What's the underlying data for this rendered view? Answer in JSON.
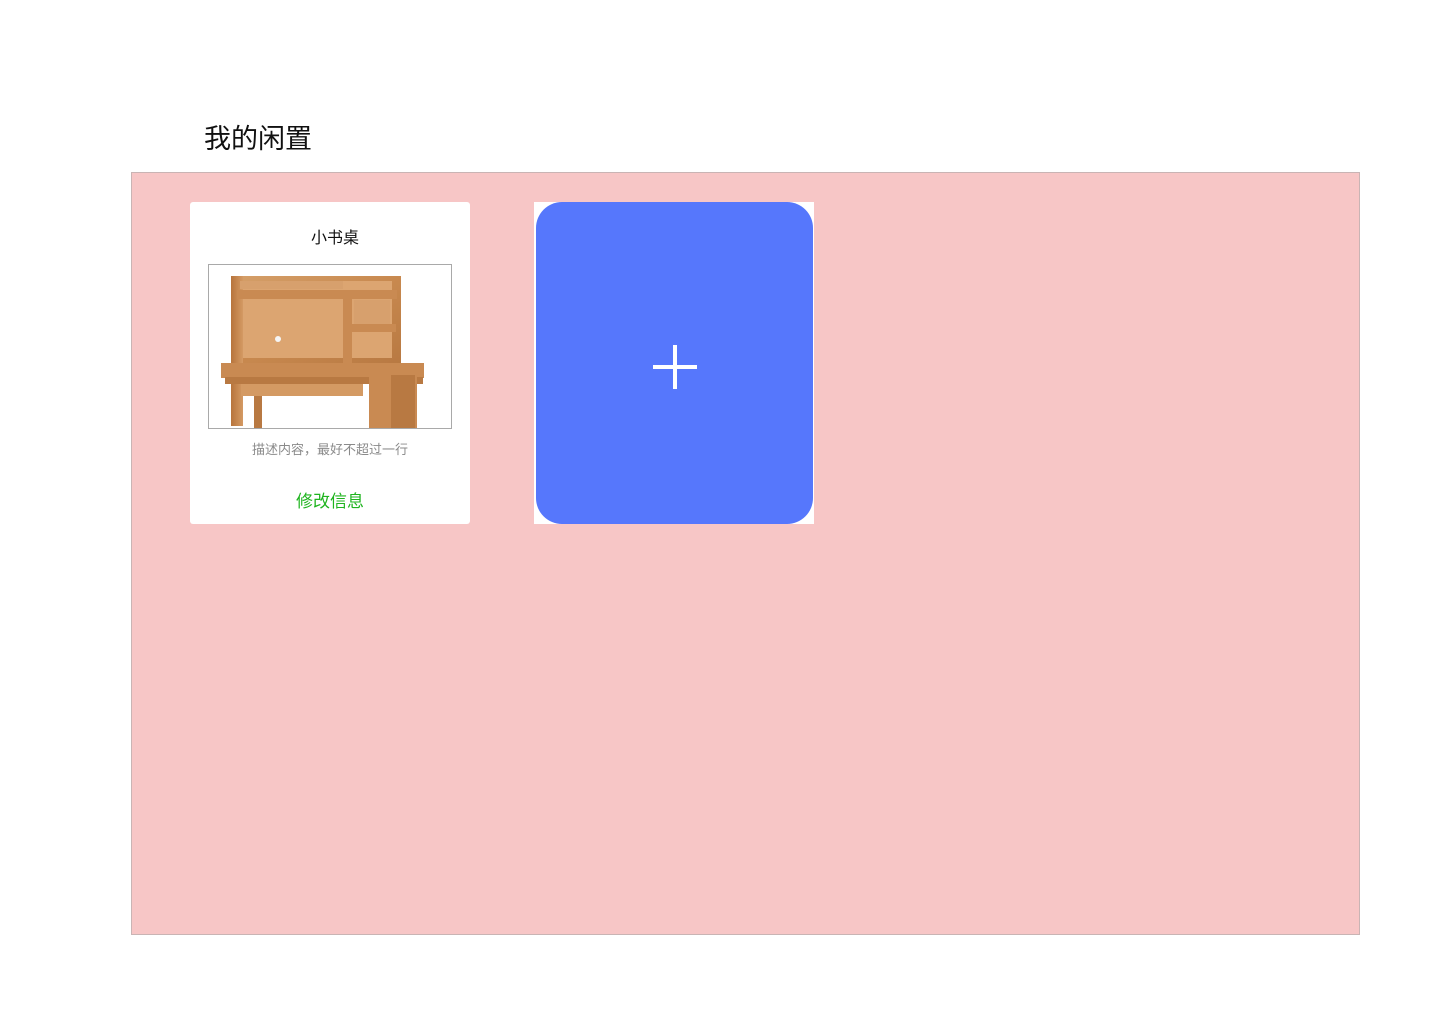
{
  "page": {
    "title": "我的闲置"
  },
  "items": [
    {
      "title": "小书桌",
      "image_icon": "desk-image",
      "description": "描述内容，最好不超过一行",
      "edit_label": "修改信息"
    }
  ],
  "add_button": {
    "icon": "plus-icon"
  },
  "colors": {
    "panel_background": "#f7c6c6",
    "add_button": "#5677fc",
    "edit_link": "#1fb41f"
  }
}
